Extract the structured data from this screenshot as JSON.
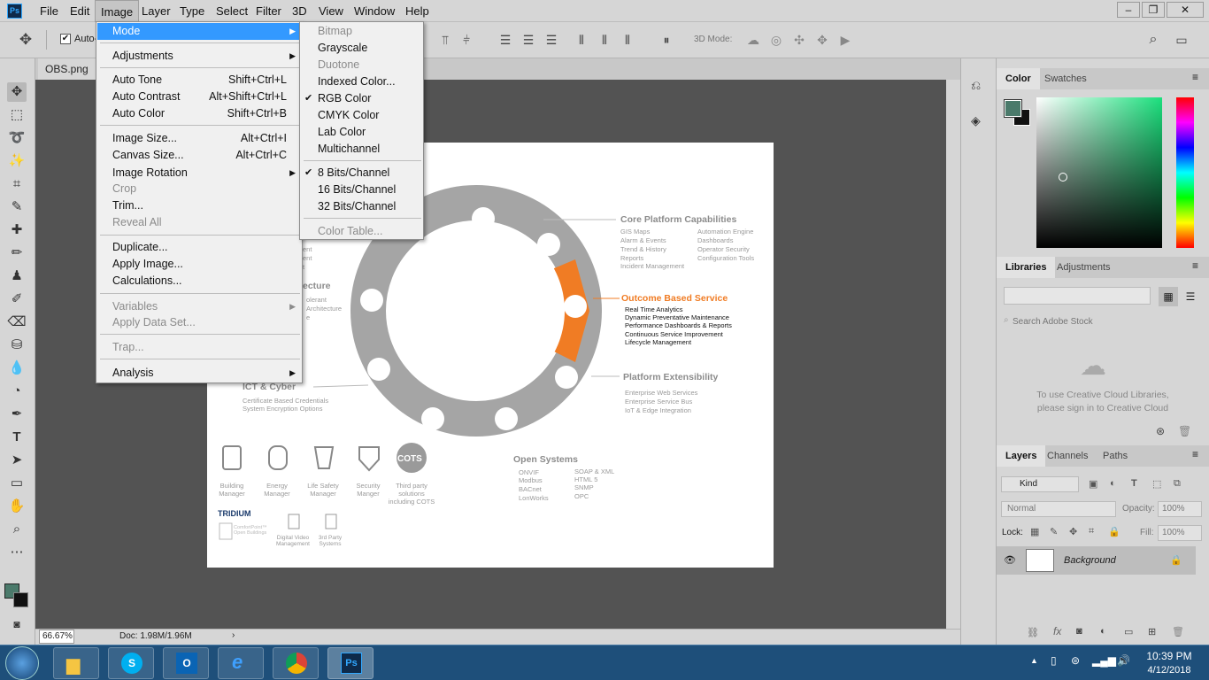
{
  "app": {
    "logo": "Ps"
  },
  "menubar": [
    "File",
    "Edit",
    "Image",
    "Layer",
    "Type",
    "Select",
    "Filter",
    "3D",
    "View",
    "Window",
    "Help"
  ],
  "window_controls": [
    "–",
    "❐",
    "✕"
  ],
  "options_bar": {
    "auto_select_label": "Auto-",
    "mode_3d_label": "3D Mode:"
  },
  "document_tab": {
    "label": "OBS.png @"
  },
  "image_menu": {
    "items": [
      {
        "label": "Mode",
        "shortcut": "",
        "submenu": true,
        "disabled": false,
        "highlighted": true
      },
      {
        "label": "Adjustments",
        "shortcut": "",
        "submenu": true,
        "disabled": false
      },
      {
        "label": "Auto Tone",
        "shortcut": "Shift+Ctrl+L",
        "disabled": false
      },
      {
        "label": "Auto Contrast",
        "shortcut": "Alt+Shift+Ctrl+L",
        "disabled": false
      },
      {
        "label": "Auto Color",
        "shortcut": "Shift+Ctrl+B",
        "disabled": false
      },
      {
        "label": "Image Size...",
        "shortcut": "Alt+Ctrl+I",
        "disabled": false
      },
      {
        "label": "Canvas Size...",
        "shortcut": "Alt+Ctrl+C",
        "disabled": false
      },
      {
        "label": "Image Rotation",
        "shortcut": "",
        "submenu": true,
        "disabled": false
      },
      {
        "label": "Crop",
        "shortcut": "",
        "disabled": true
      },
      {
        "label": "Trim...",
        "shortcut": "",
        "disabled": false
      },
      {
        "label": "Reveal All",
        "shortcut": "",
        "disabled": true
      },
      {
        "label": "Duplicate...",
        "shortcut": "",
        "disabled": false
      },
      {
        "label": "Apply Image...",
        "shortcut": "",
        "disabled": false
      },
      {
        "label": "Calculations...",
        "shortcut": "",
        "disabled": false
      },
      {
        "label": "Variables",
        "shortcut": "",
        "submenu": true,
        "disabled": true
      },
      {
        "label": "Apply Data Set...",
        "shortcut": "",
        "disabled": true
      },
      {
        "label": "Trap...",
        "shortcut": "",
        "disabled": true
      },
      {
        "label": "Analysis",
        "shortcut": "",
        "submenu": true,
        "disabled": false
      }
    ]
  },
  "mode_submenu": {
    "items": [
      {
        "label": "Bitmap",
        "checked": false,
        "disabled": true
      },
      {
        "label": "Grayscale",
        "checked": false,
        "disabled": false
      },
      {
        "label": "Duotone",
        "checked": false,
        "disabled": true
      },
      {
        "label": "Indexed Color...",
        "checked": false,
        "disabled": false
      },
      {
        "label": "RGB Color",
        "checked": true,
        "disabled": false
      },
      {
        "label": "CMYK Color",
        "checked": false,
        "disabled": false
      },
      {
        "label": "Lab Color",
        "checked": false,
        "disabled": false
      },
      {
        "label": "Multichannel",
        "checked": false,
        "disabled": false
      },
      {
        "label": "8 Bits/Channel",
        "checked": true,
        "disabled": false
      },
      {
        "label": "16 Bits/Channel",
        "checked": false,
        "disabled": false
      },
      {
        "label": "32 Bits/Channel",
        "checked": false,
        "disabled": false
      },
      {
        "label": "Color Table...",
        "checked": false,
        "disabled": true
      }
    ]
  },
  "diagram": {
    "core_title": "Core Platform Capabilities",
    "core_left": [
      "GIS Maps",
      "Alarm & Events",
      "Trend & History",
      "Reports",
      "Incident Management"
    ],
    "core_right": [
      "Automation Engine",
      "Dashboards",
      "Operator Security",
      "Configuration Tools"
    ],
    "outcome_title": "Outcome Based Service",
    "outcome_items": [
      "Real Time Analytics",
      "Dynamic Preventative Maintenance",
      "Performance Dashboards & Reports",
      "Continuous Service Improvement",
      "Lifecycle Management"
    ],
    "ext_title": "Platform Extensibility",
    "ext_items": [
      "Enterprise Web Services",
      "Enterprise Service Bus",
      "IoT & Edge Integration"
    ],
    "open_title": "Open Systems",
    "open_left": [
      "ONVIF",
      "Modbus",
      "BACnet",
      "LonWorks"
    ],
    "open_right": [
      "SOAP & XML",
      "HTML 5",
      "SNMP",
      "OPC"
    ],
    "ict_title": "ICT & Cyber",
    "ict_items": [
      "Certificate Based Credentials",
      "System Encryption Options"
    ],
    "arch_title": "ecture",
    "arch_items": [
      "olerant",
      "Architecture",
      "e"
    ],
    "partial_left": [
      "ent",
      "ent",
      "t"
    ],
    "cots_badge": "COTS",
    "bottom_icons": [
      "Building Manager",
      "Energy Manager",
      "Life Safety Manager",
      "Security Manger",
      "Third party solutions including COTS"
    ],
    "brand": "TRIDIUM",
    "brand_sub": "ComfortPoint™ Open Buildings",
    "bottom_icons2": [
      "Digital Video Management",
      "3rd Party Systems"
    ]
  },
  "status": {
    "zoom": "66.67%",
    "doc": "Doc: 1.98M/1.96M"
  },
  "panels": {
    "color_tabs": [
      "Color",
      "Swatches"
    ],
    "libraries_tabs": [
      "Libraries",
      "Adjustments"
    ],
    "search_placeholder": "Search Adobe Stock",
    "cc_message_1": "To use Creative Cloud Libraries,",
    "cc_message_2": "please sign in to Creative Cloud",
    "layers_tabs": [
      "Layers",
      "Channels",
      "Paths"
    ],
    "kind_label": "Kind",
    "blend_mode": "Normal",
    "opacity_label": "Opacity:",
    "opacity_value": "100%",
    "lock_label": "Lock:",
    "fill_label": "Fill:",
    "fill_value": "100%",
    "layer_name": "Background"
  },
  "taskbar": {
    "time": "10:39 PM",
    "date": "4/12/2018"
  },
  "colors": {
    "accent_orange": "#f07c24",
    "highlight": "#3399ff",
    "foreground": "#4b7a6b",
    "background": "#111111"
  }
}
